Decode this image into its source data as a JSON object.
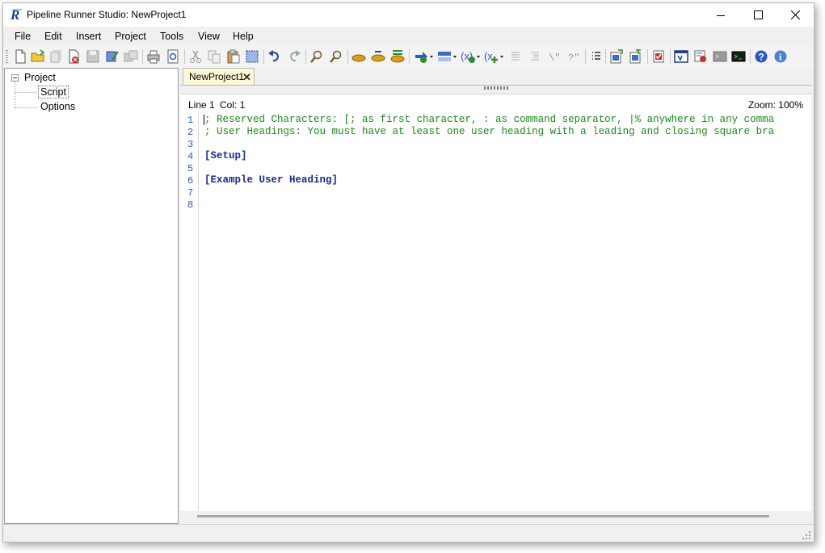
{
  "window": {
    "title": "Pipeline Runner Studio: NewProject1",
    "logo_icon": "pipeline-runner-logo-icon",
    "controls": [
      "minimize-icon",
      "maximize-icon",
      "close-icon"
    ]
  },
  "menu": {
    "items": [
      "File",
      "Edit",
      "Insert",
      "Project",
      "Tools",
      "View",
      "Help"
    ]
  },
  "toolbar": {
    "icons": [
      "new-file-icon",
      "open-folder-icon",
      "open-recent-icon",
      "close-file-icon",
      "save-icon",
      "save-as-icon",
      "save-all-icon",
      "print-icon",
      "print-preview-icon",
      "cut-icon",
      "copy-icon",
      "paste-icon",
      "select-all-icon",
      "undo-icon",
      "redo-icon",
      "find-icon",
      "find-next-icon",
      "replace-icon",
      "replace-next-icon",
      "replace-all-icon",
      "insert-command-dropdown-icon",
      "insert-heading-dropdown-icon",
      "insert-variable-dropdown-icon",
      "add-variable-dropdown-icon",
      "comment-icon",
      "uncomment-icon",
      "indent-icon",
      "outdent-icon",
      "bookmark-list-icon",
      "import-icon",
      "export-icon",
      "validate-icon",
      "run-window-icon",
      "run-settings-icon",
      "console-disabled-icon",
      "console-icon",
      "help-icon",
      "about-icon"
    ]
  },
  "tree": {
    "root": "Project",
    "children": [
      "Script",
      "Options"
    ],
    "selected": "Script"
  },
  "tab": {
    "label": "NewProject1",
    "close_icon": "close-tab-icon"
  },
  "editor": {
    "line_label": "Line 1",
    "col_label": "Col: 1",
    "zoom_label": "Zoom: 100%",
    "line_numbers": [
      "1",
      "2",
      "3",
      "4",
      "5",
      "6",
      "7",
      "8"
    ],
    "lines": [
      "; Reserved Characters: [; as first character, : as command separator, |% anywhere in any comma",
      "; User Headings: You must have at least one user heading with a leading and closing square bra",
      "",
      "[Setup]",
      "",
      "[Example User Heading]",
      "",
      ""
    ]
  },
  "colors": {
    "comment": "#1a8a1a",
    "heading": "#1a2c8c",
    "line_number": "#2b57c8",
    "tab_background": "#fdf8d6"
  }
}
